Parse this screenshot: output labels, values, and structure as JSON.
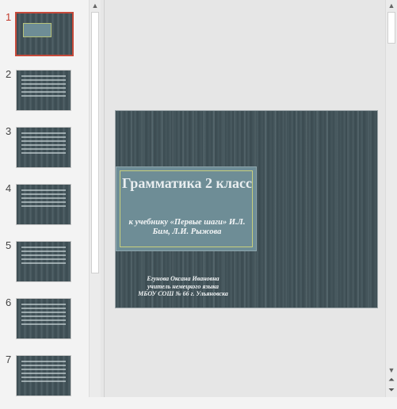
{
  "thumbnails": [
    {
      "number": "1",
      "selected": true
    },
    {
      "number": "2",
      "selected": false
    },
    {
      "number": "3",
      "selected": false
    },
    {
      "number": "4",
      "selected": false
    },
    {
      "number": "5",
      "selected": false
    },
    {
      "number": "6",
      "selected": false
    },
    {
      "number": "7",
      "selected": false
    }
  ],
  "slide": {
    "title": "Грамматика 2 класс",
    "subtitle": "к учебнику «Первые шаги» И.Л. Бим, Л.И. Рыжова",
    "author_line1": "Егунова Оксана Ивановна",
    "author_line2": "учитель немецкого языка",
    "author_line3": "МБОУ СОШ № 66 г. Ульяновска"
  },
  "icons": {
    "scroll_up": "scroll-up-arrow",
    "scroll_down": "scroll-down-arrow",
    "prev_slide": "previous-slide-double-arrow",
    "next_slide": "next-slide-double-arrow"
  },
  "colors": {
    "selected_accent": "#c5493a",
    "slide_background": "#3f4f55",
    "title_box": "#6e8d96",
    "title_border": "#c9cf7c"
  }
}
